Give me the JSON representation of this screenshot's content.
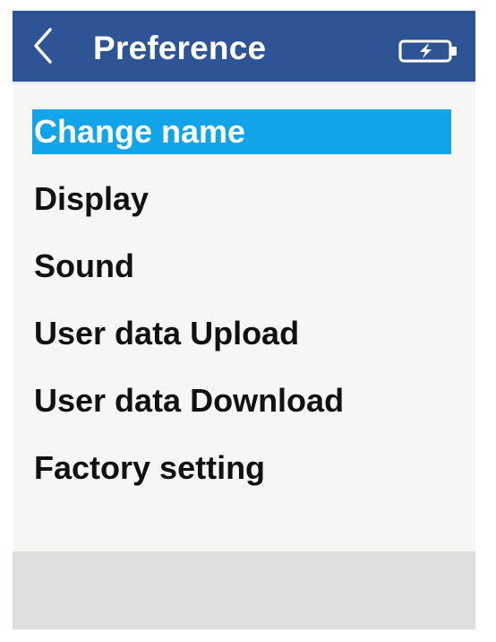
{
  "header": {
    "title": "Preference",
    "back_icon": "chevron-left-icon",
    "battery_icon": "battery-charging-icon",
    "background_color": "#2f5496"
  },
  "menu": {
    "selected_index": 0,
    "highlight_color": "#11a4e8",
    "items": [
      {
        "label": "Change name"
      },
      {
        "label": "Display"
      },
      {
        "label": "Sound"
      },
      {
        "label": "User data Upload"
      },
      {
        "label": "User data Download"
      },
      {
        "label": "Factory setting"
      }
    ]
  }
}
